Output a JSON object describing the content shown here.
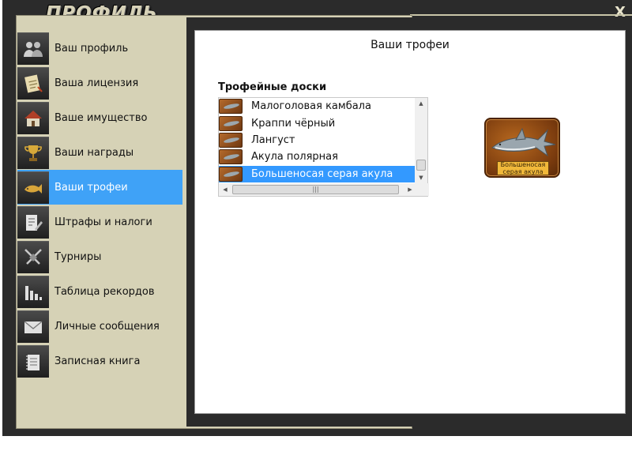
{
  "window": {
    "title": "ПРОФИЛЬ",
    "close_glyph": "X"
  },
  "menu": [
    {
      "label": "Ваш профиль",
      "icon": "users-icon",
      "active": false
    },
    {
      "label": "Ваша лицензия",
      "icon": "license-icon",
      "active": false
    },
    {
      "label": "Ваше имущество",
      "icon": "house-icon",
      "active": false
    },
    {
      "label": "Ваши награды",
      "icon": "trophy-cup-icon",
      "active": false
    },
    {
      "label": "Ваши трофеи",
      "icon": "fish-trophy-icon",
      "active": true
    },
    {
      "label": "Штрафы и налоги",
      "icon": "document-pen-icon",
      "active": false
    },
    {
      "label": "Турниры",
      "icon": "crossed-swords-icon",
      "active": false
    },
    {
      "label": "Таблица рекордов",
      "icon": "bar-chart-icon",
      "active": false
    },
    {
      "label": "Личные сообщения",
      "icon": "envelope-icon",
      "active": false
    },
    {
      "label": "Записная книга",
      "icon": "notebook-icon",
      "active": false
    }
  ],
  "content": {
    "title": "Ваши трофеи",
    "list_title": "Трофейные доски",
    "items": [
      {
        "label": "Малоголовая камбала",
        "selected": false
      },
      {
        "label": "Краппи чёрный",
        "selected": false
      },
      {
        "label": "Лангуст",
        "selected": false
      },
      {
        "label": "Акула полярная",
        "selected": false
      },
      {
        "label": "Большеносая серая акула",
        "selected": true
      }
    ],
    "hscroll_grip": "|||",
    "preview": {
      "label_line1": "Большеносая",
      "label_line2": "серая акула"
    }
  },
  "colors": {
    "accent": "#3fa2f7",
    "panel": "#d6d2b6",
    "frame": "#2b2b2b",
    "selection": "#3399ff"
  }
}
